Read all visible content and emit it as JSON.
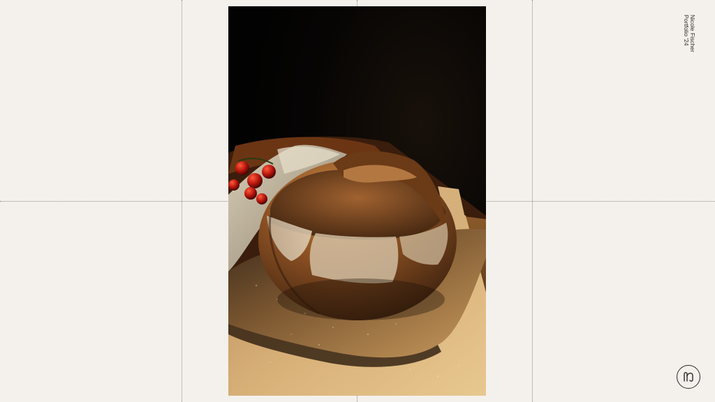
{
  "portfolio": {
    "author_name": "Nicole Fischer",
    "edition_label": "Portfolio '24"
  },
  "photo": {
    "subject": "rustic-sourdough-loaf",
    "elements": [
      "bread-loaf",
      "cherry-tomatoes",
      "linen-cloth",
      "wooden-board"
    ]
  },
  "logo": {
    "icon": "monogram-logo-icon"
  },
  "colors": {
    "background": "#f4f1ec",
    "guide_lines": "#8f8a84",
    "text": "#2b2926"
  }
}
